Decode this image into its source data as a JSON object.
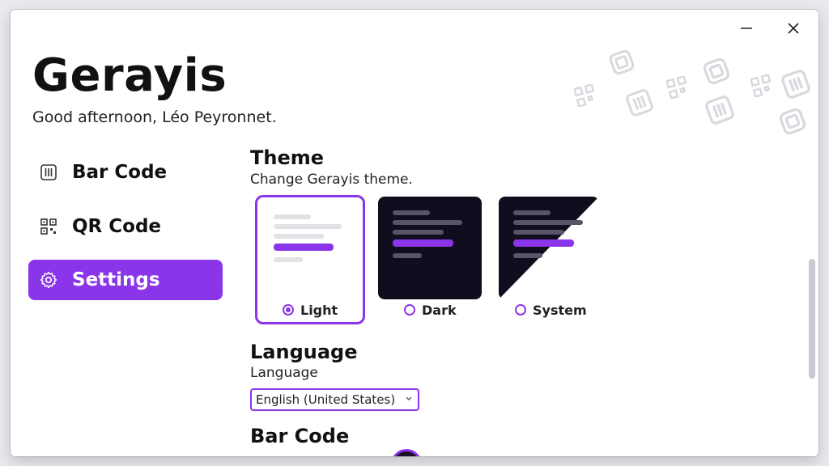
{
  "window": {
    "controls": {
      "minimize_icon": "minimize-icon",
      "close_icon": "close-icon"
    }
  },
  "header": {
    "title": "Gerayis",
    "greeting": "Good afternoon, Léo Peyronnet."
  },
  "sidebar": {
    "items": [
      {
        "label": "Bar Code",
        "icon": "barcode-icon",
        "active": false
      },
      {
        "label": "QR Code",
        "icon": "qrcode-icon",
        "active": false
      },
      {
        "label": "Settings",
        "icon": "gear-icon",
        "active": true
      }
    ]
  },
  "settings": {
    "theme": {
      "title": "Theme",
      "subtitle": "Change Gerayis theme.",
      "options": [
        {
          "label": "Light",
          "selected": true
        },
        {
          "label": "Dark",
          "selected": false
        },
        {
          "label": "System",
          "selected": false
        }
      ]
    },
    "language": {
      "title": "Language",
      "subtitle": "Language",
      "selected": "English (United States)"
    },
    "barcode": {
      "title": "Bar Code"
    }
  },
  "colors": {
    "accent": "#8a35ea",
    "dark_preview": "#0f0d1e",
    "light_preview": "#ffffff"
  }
}
